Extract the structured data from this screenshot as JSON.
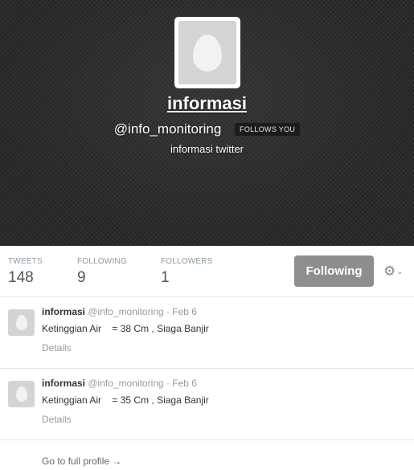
{
  "profile": {
    "name": "informasi",
    "handle": "@info_monitoring",
    "follows_badge": "FOLLOWS YOU",
    "bio": "informasi twitter"
  },
  "stats": {
    "tweets_label": "TWEETS",
    "tweets_value": "148",
    "following_label": "FOLLOWING",
    "following_value": "9",
    "followers_label": "FOLLOWERS",
    "followers_value": "1"
  },
  "actions": {
    "following_button": "Following",
    "gear_icon": "⚙",
    "chevron_icon": "⌄"
  },
  "tweets": [
    {
      "name": "informasi",
      "handle": "@info_monitoring",
      "date": "Feb 6",
      "text": "Ketinggian Air    = 38 Cm , Siaga Banjir",
      "details": "Details"
    },
    {
      "name": "informasi",
      "handle": "@info_monitoring",
      "date": "Feb 6",
      "text": "Ketinggian Air    = 35 Cm , Siaga Banjir",
      "details": "Details"
    }
  ],
  "footer": {
    "full_profile": "Go to full profile →"
  },
  "colors": {
    "header_bg": "#2a2a2a",
    "button_bg": "#8e8e8e",
    "muted_text": "#999999"
  },
  "icons": [
    "egg-avatar-icon",
    "gear-icon",
    "chevron-down-icon"
  ]
}
